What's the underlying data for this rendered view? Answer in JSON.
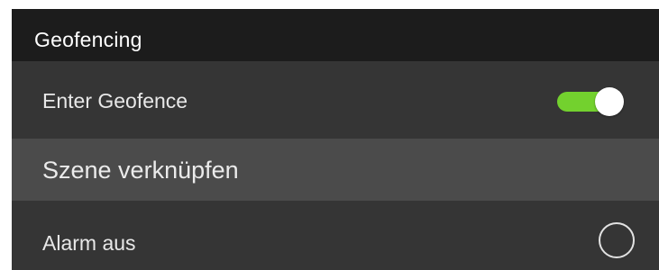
{
  "header": {
    "title": "Geofencing"
  },
  "rows": {
    "enter_geofence": {
      "label": "Enter Geofence",
      "toggle_on": true
    },
    "link_scene": {
      "label": "Szene verknüpfen"
    },
    "alarm_off": {
      "label": "Alarm aus",
      "selected": false
    }
  },
  "colors": {
    "header_bg": "#1c1c1c",
    "row_bg": "#353535",
    "row_highlight_bg": "#4b4b4b",
    "toggle_accent": "#73d12e",
    "text": "#e8e8e8"
  },
  "icons": {
    "toggle": "toggle-switch-on",
    "radio": "radio-button-unchecked"
  }
}
